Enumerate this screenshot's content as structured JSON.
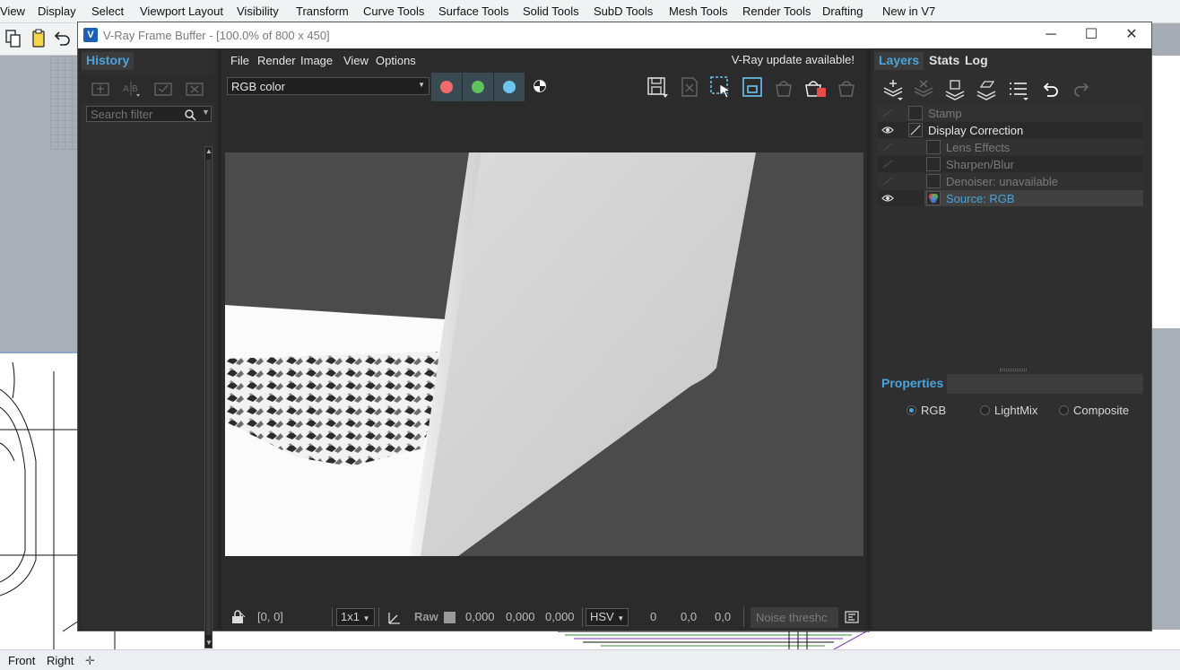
{
  "rhino": {
    "menu": [
      "View",
      "Display",
      "Select",
      "Viewport Layout",
      "Visibility",
      "Transform",
      "Curve Tools",
      "Surface Tools",
      "Solid Tools",
      "SubD Tools",
      "Mesh Tools",
      "Render Tools",
      "Drafting",
      "New in V7"
    ],
    "viewport_tabs": [
      "Front",
      "Right"
    ]
  },
  "vfb": {
    "title": "V-Ray Frame Buffer - [100.0% of 800 x 450]",
    "menu": [
      "File",
      "Render",
      "Image",
      "View",
      "Options"
    ],
    "update_notice": "V-Ray update available!",
    "channel": "RGB color",
    "history": {
      "tab": "History",
      "search_placeholder": "Search filter"
    },
    "status": {
      "coords": "[0, 0]",
      "zoom": "1x1",
      "raw_label": "Raw",
      "rgb_values": [
        "0,000",
        "0,000",
        "0,000"
      ],
      "color_mode": "HSV",
      "hsv_values": [
        "0",
        "0,0",
        "0,0"
      ],
      "noise_field": "Noise threshc"
    },
    "right_tabs": [
      "Layers",
      "Stats",
      "Log"
    ],
    "layers": [
      {
        "name": "Stamp",
        "visible": false
      },
      {
        "name": "Display Correction",
        "visible": true
      },
      {
        "name": "Lens Effects",
        "visible": false
      },
      {
        "name": "Sharpen/Blur",
        "visible": false
      },
      {
        "name": "Denoiser: unavailable",
        "visible": false
      },
      {
        "name": "Source: RGB",
        "visible": true,
        "selected": true
      }
    ],
    "properties": {
      "title": "Properties",
      "options": [
        "RGB",
        "LightMix",
        "Composite"
      ],
      "selected": "RGB"
    }
  },
  "colors": {
    "accent": "#4aa4dd",
    "red_channel": "#f06a6a",
    "green_channel": "#5ec25e",
    "blue_channel": "#6cc4ef"
  }
}
